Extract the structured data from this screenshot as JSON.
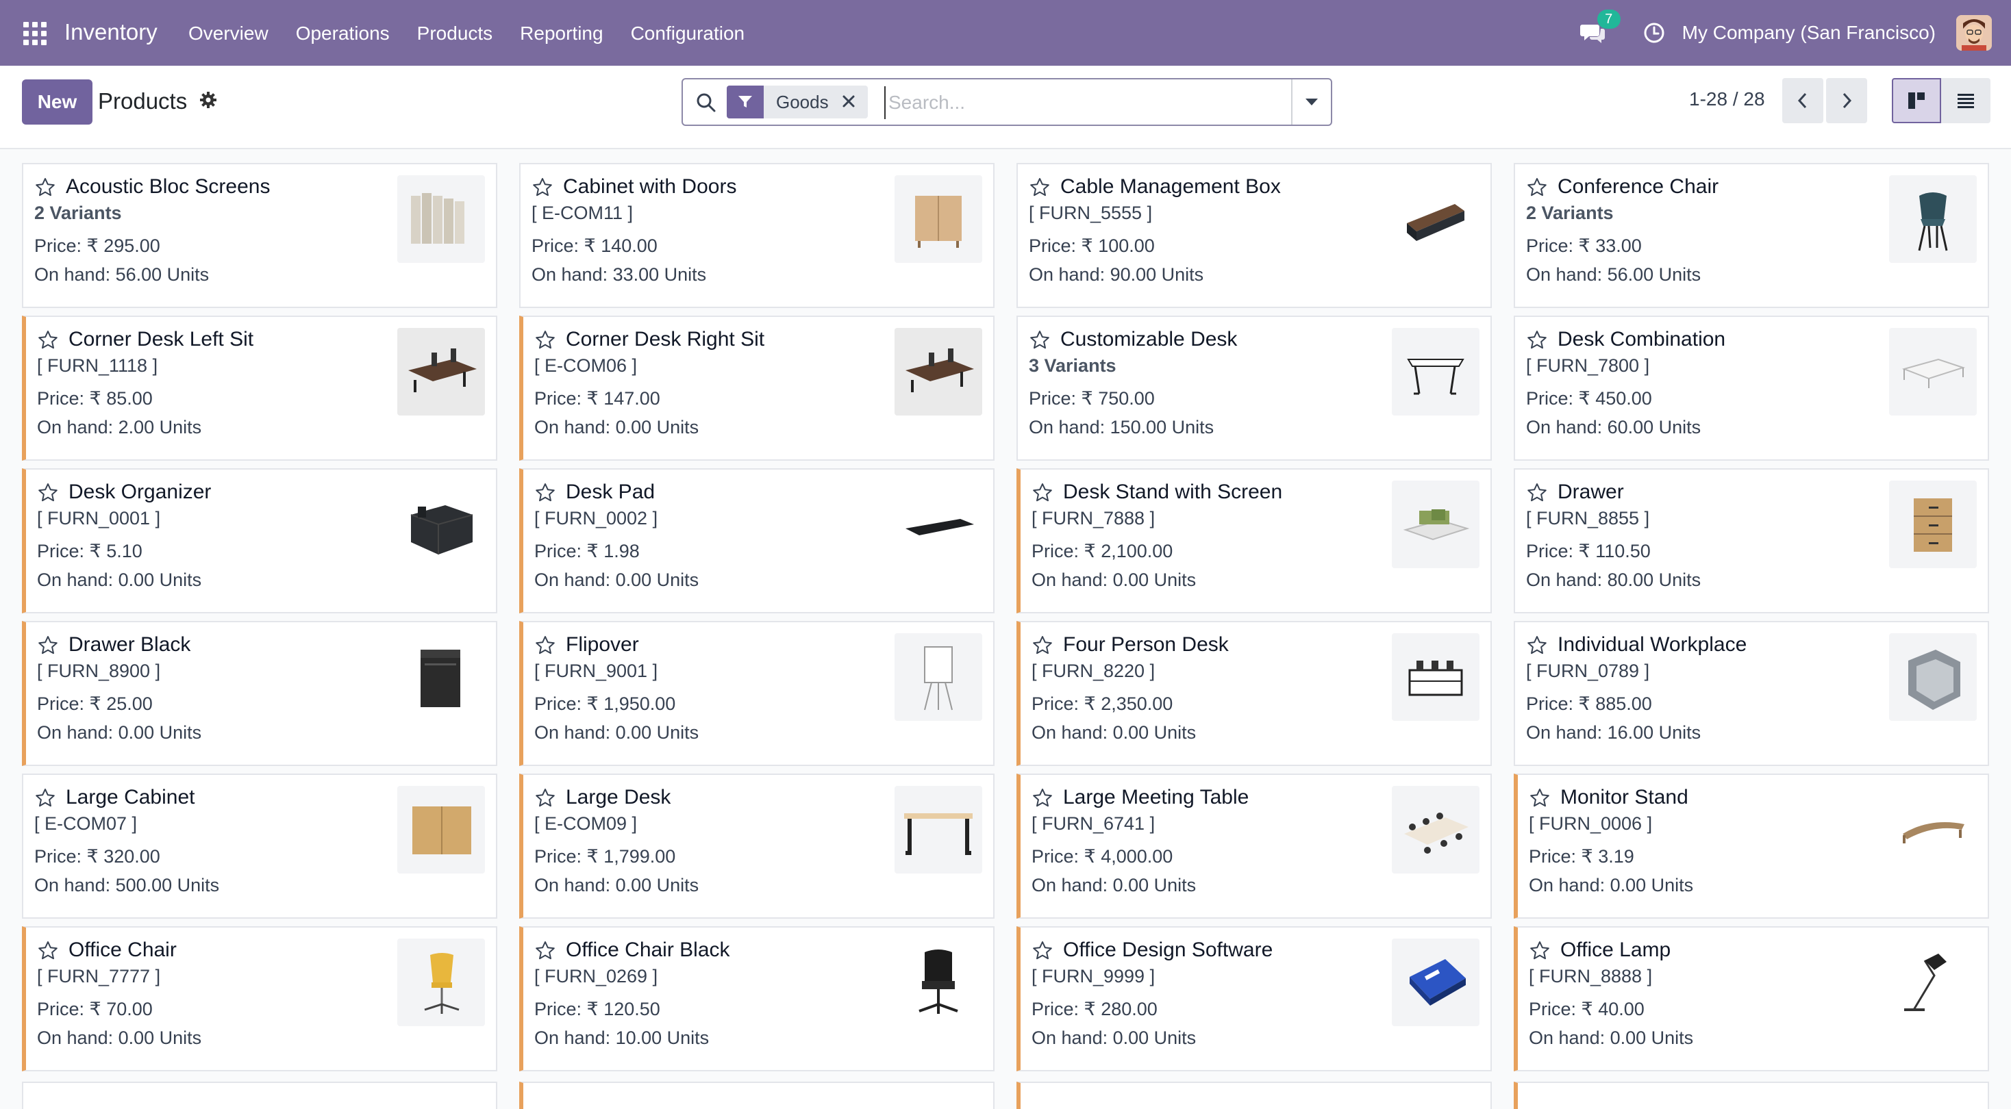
{
  "navbar": {
    "brand": "Inventory",
    "menu": [
      "Overview",
      "Operations",
      "Products",
      "Reporting",
      "Configuration"
    ],
    "chat_count": "7",
    "company": "My Company (San Francisco)"
  },
  "control": {
    "new_label": "New",
    "title": "Products",
    "facet_label": "Goods",
    "search_placeholder": "Search...",
    "pager": "1-28 / 28"
  },
  "products": [
    {
      "name": "Acoustic Bloc Screens",
      "ref": "2 Variants",
      "variants": true,
      "price": "Price: ₹ 295.00",
      "onhand": "On hand: 56.00 Units",
      "accent": false,
      "img": "screens"
    },
    {
      "name": "Cabinet with Doors",
      "ref": "[ E-COM11 ]",
      "variants": false,
      "price": "Price: ₹ 140.00",
      "onhand": "On hand: 33.00 Units",
      "accent": false,
      "img": "cabinet"
    },
    {
      "name": "Cable Management Box",
      "ref": "[ FURN_5555 ]",
      "variants": false,
      "price": "Price: ₹ 100.00",
      "onhand": "On hand: 90.00 Units",
      "accent": false,
      "img": "cablebox"
    },
    {
      "name": "Conference Chair",
      "ref": "2 Variants",
      "variants": true,
      "price": "Price: ₹ 33.00",
      "onhand": "On hand: 56.00 Units",
      "accent": false,
      "img": "confchair"
    },
    {
      "name": "Corner Desk Left Sit",
      "ref": "[ FURN_1118 ]",
      "variants": false,
      "price": "Price: ₹ 85.00",
      "onhand": "On hand: 2.00 Units",
      "accent": true,
      "img": "cornerdesk"
    },
    {
      "name": "Corner Desk Right Sit",
      "ref": "[ E-COM06 ]",
      "variants": false,
      "price": "Price: ₹ 147.00",
      "onhand": "On hand: 0.00 Units",
      "accent": true,
      "img": "cornerdesk"
    },
    {
      "name": "Customizable Desk",
      "ref": "3 Variants",
      "variants": true,
      "price": "Price: ₹ 750.00",
      "onhand": "On hand: 150.00 Units",
      "accent": false,
      "img": "desk"
    },
    {
      "name": "Desk Combination",
      "ref": "[ FURN_7800 ]",
      "variants": false,
      "price": "Price: ₹ 450.00",
      "onhand": "On hand: 60.00 Units",
      "accent": false,
      "img": "deskcombo"
    },
    {
      "name": "Desk Organizer",
      "ref": "[ FURN_0001 ]",
      "variants": false,
      "price": "Price: ₹ 5.10",
      "onhand": "On hand: 0.00 Units",
      "accent": true,
      "img": "organizer"
    },
    {
      "name": "Desk Pad",
      "ref": "[ FURN_0002 ]",
      "variants": false,
      "price": "Price: ₹ 1.98",
      "onhand": "On hand: 0.00 Units",
      "accent": true,
      "img": "deskpad"
    },
    {
      "name": "Desk Stand with Screen",
      "ref": "[ FURN_7888 ]",
      "variants": false,
      "price": "Price: ₹ 2,100.00",
      "onhand": "On hand: 0.00 Units",
      "accent": true,
      "img": "deskstand"
    },
    {
      "name": "Drawer",
      "ref": "[ FURN_8855 ]",
      "variants": false,
      "price": "Price: ₹ 110.50",
      "onhand": "On hand: 80.00 Units",
      "accent": false,
      "img": "drawer"
    },
    {
      "name": "Drawer Black",
      "ref": "[ FURN_8900 ]",
      "variants": false,
      "price": "Price: ₹ 25.00",
      "onhand": "On hand: 0.00 Units",
      "accent": true,
      "img": "drawerblack"
    },
    {
      "name": "Flipover",
      "ref": "[ FURN_9001 ]",
      "variants": false,
      "price": "Price: ₹ 1,950.00",
      "onhand": "On hand: 0.00 Units",
      "accent": true,
      "img": "flipover"
    },
    {
      "name": "Four Person Desk",
      "ref": "[ FURN_8220 ]",
      "variants": false,
      "price": "Price: ₹ 2,350.00",
      "onhand": "On hand: 0.00 Units",
      "accent": true,
      "img": "fourdesk"
    },
    {
      "name": "Individual Workplace",
      "ref": "[ FURN_0789 ]",
      "variants": false,
      "price": "Price: ₹ 885.00",
      "onhand": "On hand: 16.00 Units",
      "accent": false,
      "img": "workplace"
    },
    {
      "name": "Large Cabinet",
      "ref": "[ E-COM07 ]",
      "variants": false,
      "price": "Price: ₹ 320.00",
      "onhand": "On hand: 500.00 Units",
      "accent": false,
      "img": "largecabinet"
    },
    {
      "name": "Large Desk",
      "ref": "[ E-COM09 ]",
      "variants": false,
      "price": "Price: ₹ 1,799.00",
      "onhand": "On hand: 0.00 Units",
      "accent": true,
      "img": "largedesk"
    },
    {
      "name": "Large Meeting Table",
      "ref": "[ FURN_6741 ]",
      "variants": false,
      "price": "Price: ₹ 4,000.00",
      "onhand": "On hand: 0.00 Units",
      "accent": true,
      "img": "meetingtable"
    },
    {
      "name": "Monitor Stand",
      "ref": "[ FURN_0006 ]",
      "variants": false,
      "price": "Price: ₹ 3.19",
      "onhand": "On hand: 0.00 Units",
      "accent": true,
      "img": "monitorstand"
    },
    {
      "name": "Office Chair",
      "ref": "[ FURN_7777 ]",
      "variants": false,
      "price": "Price: ₹ 70.00",
      "onhand": "On hand: 0.00 Units",
      "accent": true,
      "img": "officechair"
    },
    {
      "name": "Office Chair Black",
      "ref": "[ FURN_0269 ]",
      "variants": false,
      "price": "Price: ₹ 120.50",
      "onhand": "On hand: 10.00 Units",
      "accent": true,
      "img": "chairblack"
    },
    {
      "name": "Office Design Software",
      "ref": "[ FURN_9999 ]",
      "variants": false,
      "price": "Price: ₹ 280.00",
      "onhand": "On hand: 0.00 Units",
      "accent": true,
      "img": "software"
    },
    {
      "name": "Office Lamp",
      "ref": "[ FURN_8888 ]",
      "variants": false,
      "price": "Price: ₹ 40.00",
      "onhand": "On hand: 0.00 Units",
      "accent": true,
      "img": "lamp"
    }
  ],
  "colors": {
    "navbar": "#7a6b9e",
    "primary": "#71639e",
    "accent_border": "#e8a15c",
    "badge": "#21b799"
  }
}
